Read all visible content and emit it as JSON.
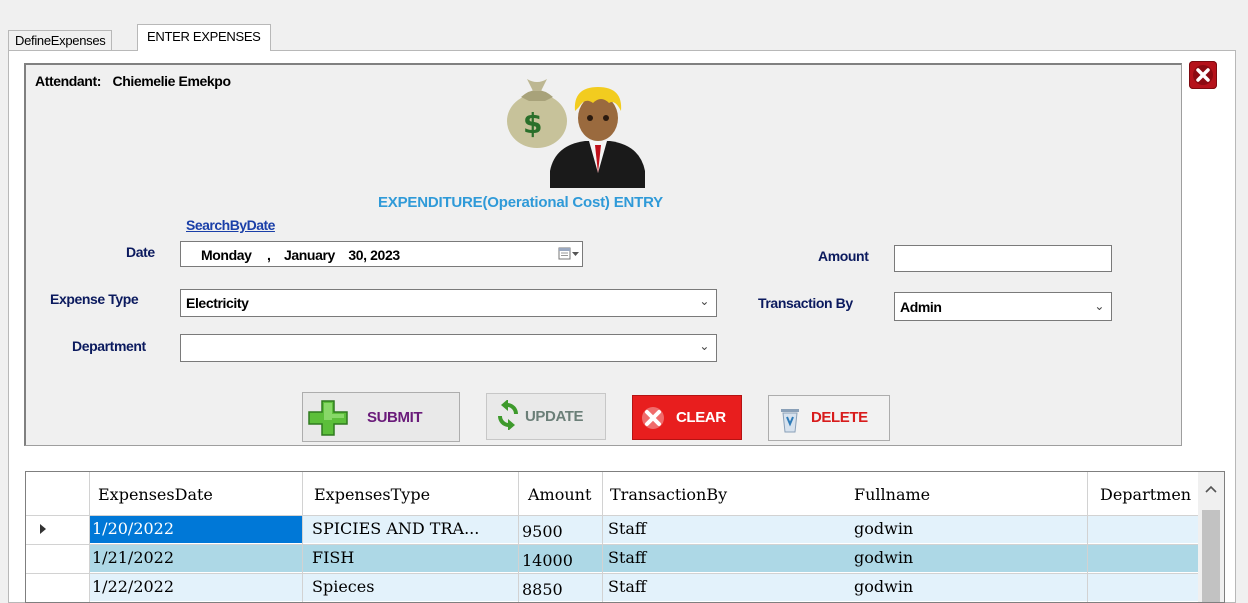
{
  "tabs": [
    {
      "label": "DefineExpenses",
      "active": false
    },
    {
      "label": "ENTER EXPENSES",
      "active": true
    }
  ],
  "attendant": {
    "label": "Attendant:",
    "name": "Chiemelie Emekpo"
  },
  "form": {
    "title": "EXPENDITURE(Operational Cost) ENTRY",
    "search_link": "SearchByDate",
    "date_label": "Date",
    "date_value": {
      "day": "Monday",
      "sep": ",",
      "month": "January",
      "daynum": "30,",
      "year": "2023"
    },
    "amount_label": "Amount",
    "amount_value": "",
    "expense_type_label": "Expense Type",
    "expense_type_value": "Electricity",
    "transaction_by_label": "Transaction By",
    "transaction_by_value": "Admin",
    "department_label": "Department",
    "department_value": ""
  },
  "buttons": {
    "submit": "SUBMIT",
    "update": "UPDATE",
    "clear": "CLEAR",
    "delete": "DELETE"
  },
  "grid": {
    "columns": [
      "ExpensesDate",
      "ExpensesType",
      "Amount",
      "TransactionBy",
      "Fullname",
      "Departmen"
    ],
    "rows": [
      {
        "date": "1/20/2022",
        "type": "SPICIES AND TRA...",
        "amount": "9500",
        "by": "Staff",
        "fullname": "godwin",
        "department": ""
      },
      {
        "date": "1/21/2022",
        "type": "FISH",
        "amount": "14000",
        "by": "Staff",
        "fullname": "godwin",
        "department": ""
      },
      {
        "date": "1/22/2022",
        "type": "Spieces",
        "amount": "8850",
        "by": "Staff",
        "fullname": "godwin",
        "department": ""
      }
    ]
  },
  "colors": {
    "accent": "#2f9ad8",
    "row_selected": "#0078d7",
    "row_alt": "#add8e6",
    "row_light": "#e3f2fb",
    "clear_button": "#e81e1e",
    "submit_text": "#6a1b7a",
    "delete_text": "#d81c1c"
  },
  "icons": [
    "close-icon",
    "money-bag-person-icon",
    "plus-icon",
    "refresh-icon",
    "x-icon",
    "trash-icon",
    "row-pointer-icon",
    "scroll-up-icon"
  ]
}
